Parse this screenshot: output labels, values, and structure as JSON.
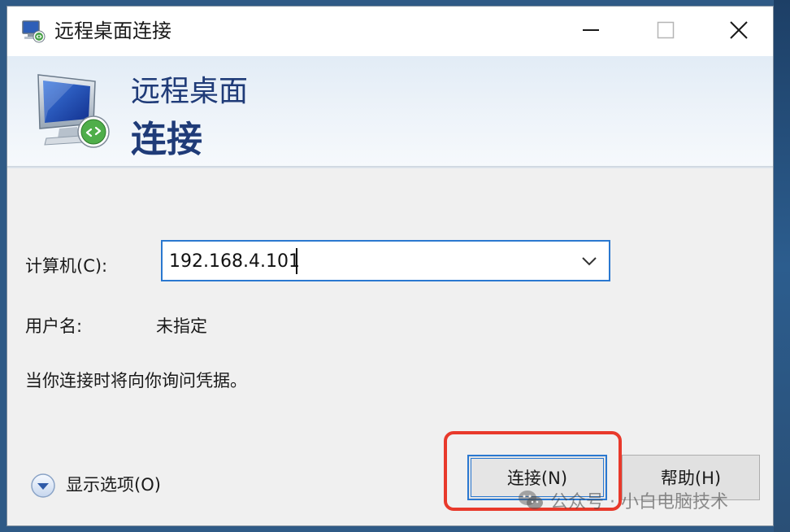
{
  "window": {
    "title": "远程桌面连接"
  },
  "banner": {
    "line1": "远程桌面",
    "line2": "连接"
  },
  "form": {
    "computer_label": "计算机(C):",
    "computer_value": "192.168.4.101",
    "username_label": "用户名:",
    "username_value": "未指定",
    "note": "当你连接时将向你询问凭据。"
  },
  "footer": {
    "show_options_label": "显示选项(O)",
    "connect_label": "连接(N)",
    "help_label": "帮助(H)"
  },
  "watermark": {
    "text": "公众号 · 小白电脑技术"
  },
  "colors": {
    "accent": "#2a78d0",
    "highlight": "#e8392b",
    "banner_text": "#1f3b78"
  }
}
